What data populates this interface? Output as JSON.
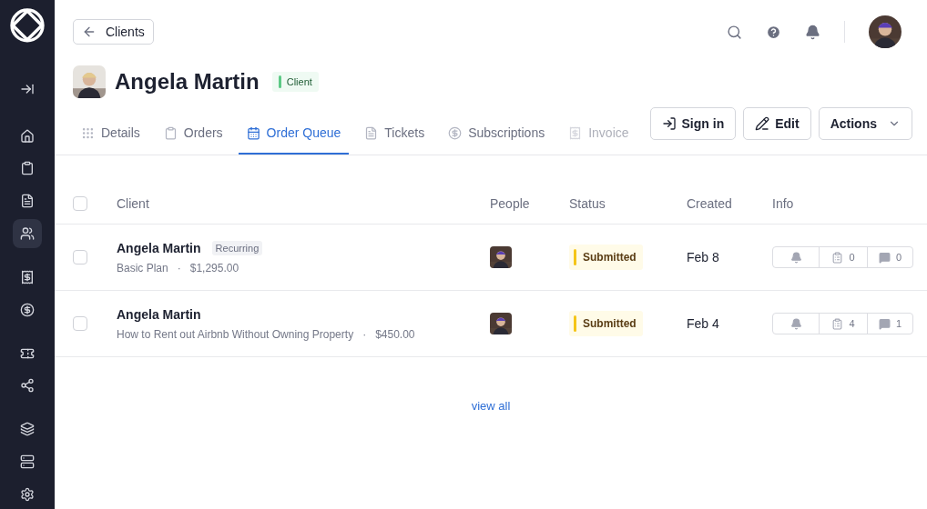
{
  "sidebar": {
    "items": [
      {
        "kind": "collapse",
        "selected": false
      },
      {
        "kind": "home",
        "selected": false
      },
      {
        "kind": "orders",
        "selected": false
      },
      {
        "kind": "queue",
        "selected": false
      },
      {
        "kind": "clients",
        "selected": true
      },
      {
        "kind": "invoices",
        "selected": false
      },
      {
        "kind": "subscriptions",
        "selected": false
      },
      {
        "kind": "coupons",
        "selected": false
      },
      {
        "kind": "network",
        "selected": false
      },
      {
        "kind": "layers",
        "selected": false
      },
      {
        "kind": "storage",
        "selected": false
      },
      {
        "kind": "settings",
        "selected": false
      }
    ]
  },
  "back_button": {
    "label": "Clients"
  },
  "header": {
    "name": "Angela Martin",
    "badge": "Client"
  },
  "tabs": [
    {
      "kind": "details",
      "label": "Details",
      "selected": false
    },
    {
      "kind": "orders",
      "label": "Orders",
      "selected": false
    },
    {
      "kind": "queue",
      "label": "Order Queue",
      "selected": true
    },
    {
      "kind": "tickets",
      "label": "Tickets",
      "selected": false
    },
    {
      "kind": "subscriptions",
      "label": "Subscriptions",
      "selected": false
    },
    {
      "kind": "invoices",
      "label": "Invoice",
      "selected": false
    }
  ],
  "actions": [
    {
      "kind": "signin",
      "label": "Sign in"
    },
    {
      "kind": "edit",
      "label": "Edit"
    },
    {
      "kind": "menu",
      "label": "Actions"
    }
  ],
  "table": {
    "select_all_checked": false,
    "columns": [
      "Client",
      "People",
      "Status",
      "Created",
      "Info"
    ],
    "rows": [
      {
        "checked": false,
        "name": "Angela Martin",
        "tag": "Recurring",
        "plan": "Basic Plan",
        "separator": "·",
        "price": "$1,295.00",
        "status": "Submitted",
        "created": "Feb 8",
        "files": "0",
        "comments": "0"
      },
      {
        "checked": false,
        "name": "Angela Martin",
        "plan": "How to Rent out Airbnb Without Owning Property",
        "separator": "·",
        "price": "$450.00",
        "status": "Submitted",
        "created": "Feb 4",
        "files": "4",
        "comments": "1"
      }
    ]
  },
  "view_all": "view all"
}
